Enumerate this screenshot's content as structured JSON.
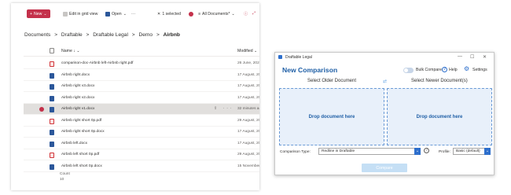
{
  "sharepoint": {
    "toolbar": {
      "new_label": "New",
      "grid_label": "Edit in grid view",
      "open_label": "Open",
      "more_label": "···",
      "selected_label": "1 selected",
      "view_label": "All Documents*",
      "filter_icon": "filter-icon",
      "expand_icon": "expand-icon"
    },
    "breadcrumb": {
      "items": [
        "Documents",
        "Draftable",
        "Draftable Legal",
        "Demo"
      ],
      "current": "Airbnb",
      "separator": ">"
    },
    "columns": {
      "name": "Name ↓ ⌄",
      "modified": "Modified ⌄"
    },
    "files": [
      {
        "name": "comparison-doc-Airbnb left-Airbnb right.pdf",
        "type": "pdf",
        "modified": "26 June, 2023",
        "selected": false
      },
      {
        "name": "Airbnb right.docx",
        "type": "docx",
        "modified": "17 August, 2022",
        "selected": false
      },
      {
        "name": "Airbnb right v3.docx",
        "type": "docx",
        "modified": "17 August, 2022",
        "selected": false
      },
      {
        "name": "Airbnb right v2.docx",
        "type": "docx",
        "modified": "17 August, 2022",
        "selected": false
      },
      {
        "name": "Airbnb right v1.docx",
        "type": "docx",
        "modified": "32 minutes ago",
        "selected": true
      },
      {
        "name": "Airbnb right short 0p.pdf",
        "type": "pdf",
        "modified": "29 August, 2022",
        "selected": false
      },
      {
        "name": "Airbnb right short 0p.docx",
        "type": "docx",
        "modified": "17 August, 2022",
        "selected": false
      },
      {
        "name": "Airbnb left.docx",
        "type": "docx",
        "modified": "17 August, 2022",
        "selected": false
      },
      {
        "name": "Airbnb left short 0p.pdf",
        "type": "pdf",
        "modified": "29 August, 2022",
        "selected": false
      },
      {
        "name": "Airbnb left short 0p.docx",
        "type": "docx",
        "modified": "15 November, 2022",
        "selected": false
      }
    ],
    "count_label": "Count",
    "count_value": "10"
  },
  "dialog": {
    "window_title": "Draftable Legal",
    "window_controls": [
      "—",
      "☐",
      "✕"
    ],
    "heading": "New Comparison",
    "bulk_compare": "Bulk Compare",
    "help": "Help",
    "settings": "Settings",
    "older_title": "Select Older Document",
    "newer_title": "Select Newer Document(s)",
    "drop_left": "Drop document here",
    "drop_right": "Drop document here",
    "comparison_type_label": "Comparison Type:",
    "comparison_type_value": "Redline in Draftable",
    "profile_label": "Profile:",
    "profile_value": "Basic (default)",
    "compare_button": "Compare"
  },
  "colors": {
    "accent": "#2e6fcc",
    "new_button": "#c4314b",
    "drop_zone": "#e8f0fa",
    "heading": "#1f5fa6"
  }
}
